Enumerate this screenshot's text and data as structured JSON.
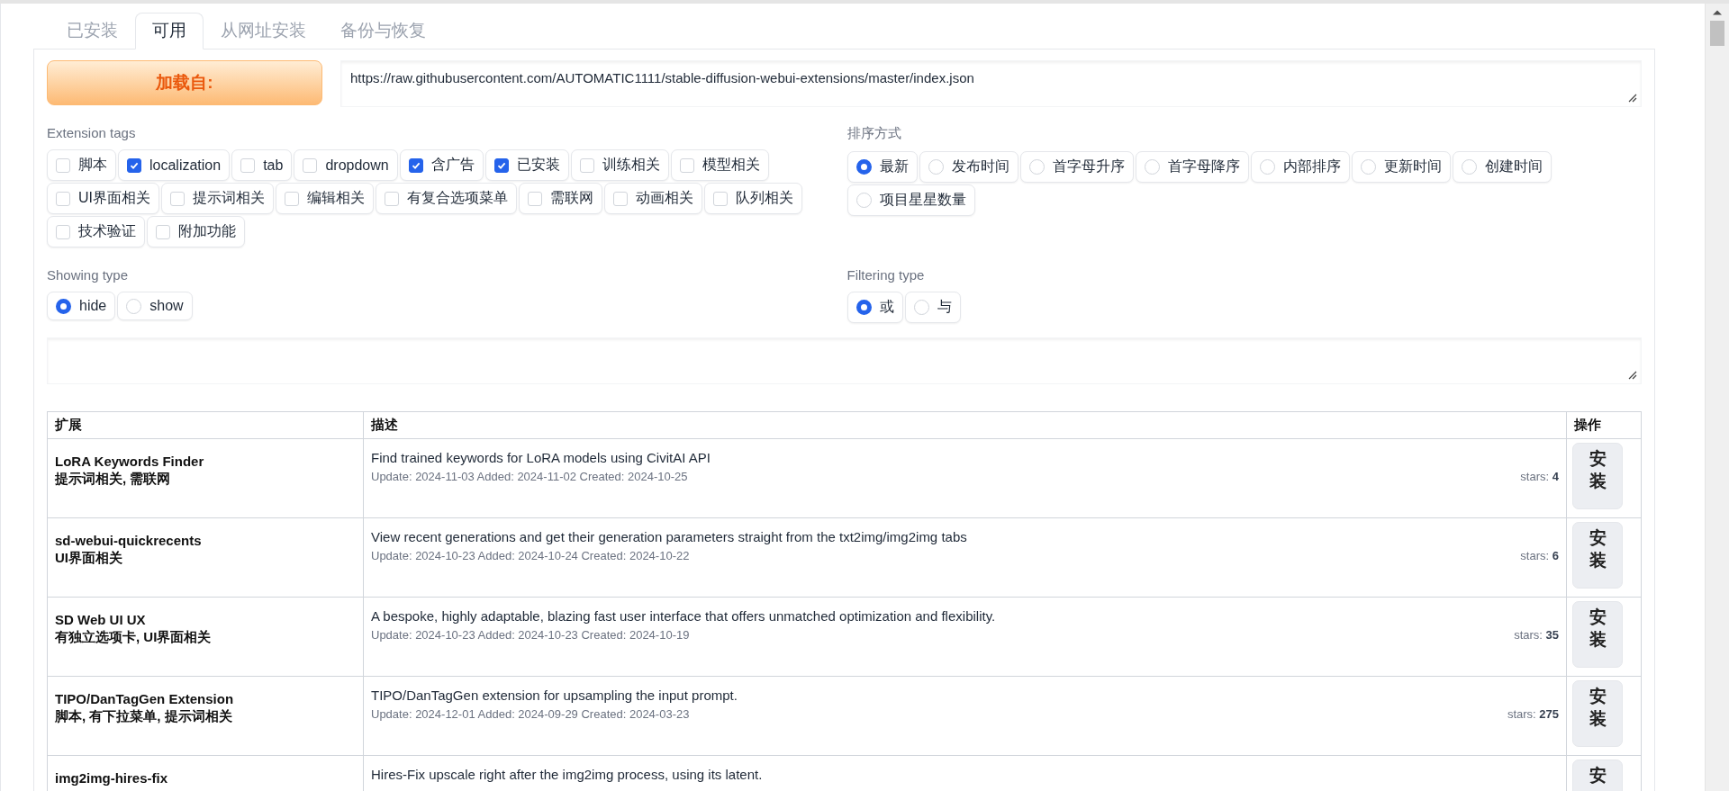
{
  "tabs": [
    {
      "label": "已安装",
      "selected": false
    },
    {
      "label": "可用",
      "selected": true
    },
    {
      "label": "从网址安装",
      "selected": false
    },
    {
      "label": "备份与恢复",
      "selected": false
    }
  ],
  "load_button": {
    "label": "加载自:"
  },
  "url_field": {
    "value": "https://raw.githubusercontent.com/AUTOMATIC1111/stable-diffusion-webui-extensions/master/index.json"
  },
  "extension_tags": {
    "label": "Extension tags",
    "options": [
      {
        "label": "脚本",
        "checked": false
      },
      {
        "label": "localization",
        "checked": true
      },
      {
        "label": "tab",
        "checked": false
      },
      {
        "label": "dropdown",
        "checked": false
      },
      {
        "label": "含广告",
        "checked": true
      },
      {
        "label": "已安装",
        "checked": true
      },
      {
        "label": "训练相关",
        "checked": false
      },
      {
        "label": "模型相关",
        "checked": false
      },
      {
        "label": "UI界面相关",
        "checked": false
      },
      {
        "label": "提示词相关",
        "checked": false
      },
      {
        "label": "编辑相关",
        "checked": false
      },
      {
        "label": "有复合选项菜单",
        "checked": false
      },
      {
        "label": "需联网",
        "checked": false
      },
      {
        "label": "动画相关",
        "checked": false
      },
      {
        "label": "队列相关",
        "checked": false
      },
      {
        "label": "技术验证",
        "checked": false
      },
      {
        "label": "附加功能",
        "checked": false
      }
    ]
  },
  "sort_order": {
    "label": "排序方式",
    "options": [
      {
        "label": "最新",
        "selected": true
      },
      {
        "label": "发布时间",
        "selected": false
      },
      {
        "label": "首字母升序",
        "selected": false
      },
      {
        "label": "首字母降序",
        "selected": false
      },
      {
        "label": "内部排序",
        "selected": false
      },
      {
        "label": "更新时间",
        "selected": false
      },
      {
        "label": "创建时间",
        "selected": false
      },
      {
        "label": "项目星星数量",
        "selected": false
      }
    ]
  },
  "showing_type": {
    "label": "Showing type",
    "options": [
      {
        "label": "hide",
        "selected": true
      },
      {
        "label": "show",
        "selected": false
      }
    ]
  },
  "filtering_type": {
    "label": "Filtering type",
    "options": [
      {
        "label": "或",
        "selected": true
      },
      {
        "label": "与",
        "selected": false
      }
    ]
  },
  "table": {
    "columns": [
      "扩展",
      "描述",
      "操作"
    ],
    "rows": [
      {
        "name": "LoRA Keywords Finder",
        "tags": "提示词相关, 需联网",
        "description": "Find trained keywords for LoRA models using CivitAI API",
        "dates": "Update: 2024-11-03 Added: 2024-11-02 Created: 2024-10-25",
        "stars_label": "stars:",
        "stars_count": "4",
        "action": "安装"
      },
      {
        "name": "sd-webui-quickrecents",
        "tags": "UI界面相关",
        "description": "View recent generations and get their generation parameters straight from the txt2img/img2img tabs",
        "dates": "Update: 2024-10-23 Added: 2024-10-24 Created: 2024-10-22",
        "stars_label": "stars:",
        "stars_count": "6",
        "action": "安装"
      },
      {
        "name": "SD Web UI UX",
        "tags": "有独立选项卡, UI界面相关",
        "description": "A bespoke, highly adaptable, blazing fast user interface that offers unmatched optimization and flexibility.",
        "dates": "Update: 2024-10-23 Added: 2024-10-23 Created: 2024-10-19",
        "stars_label": "stars:",
        "stars_count": "35",
        "action": "安装"
      },
      {
        "name": "TIPO/DanTagGen Extension",
        "tags": "脚本, 有下拉菜单, 提示词相关",
        "description": "TIPO/DanTagGen extension for upsampling the input prompt.",
        "dates": "Update: 2024-12-01 Added: 2024-09-29 Created: 2024-03-23",
        "stars_label": "stars:",
        "stars_count": "275",
        "action": "安装"
      },
      {
        "name": "img2img-hires-fix",
        "description": "Hires-Fix upscale right after the img2img process, using its latent.",
        "action": "安"
      }
    ]
  }
}
